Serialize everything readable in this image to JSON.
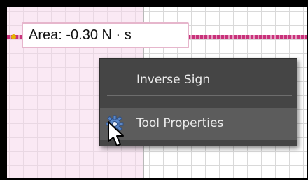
{
  "area_label": {
    "text": "Area: -0.30 N · s"
  },
  "context_menu": {
    "items": [
      {
        "label": "Inverse Sign"
      },
      {
        "label": "Tool Properties",
        "icon": "gear-icon"
      }
    ]
  },
  "colors": {
    "trace": "#c8327a",
    "menu_bg": "#454545",
    "menu_highlight": "#5c5c5c",
    "label_border": "#e6b6cc"
  }
}
